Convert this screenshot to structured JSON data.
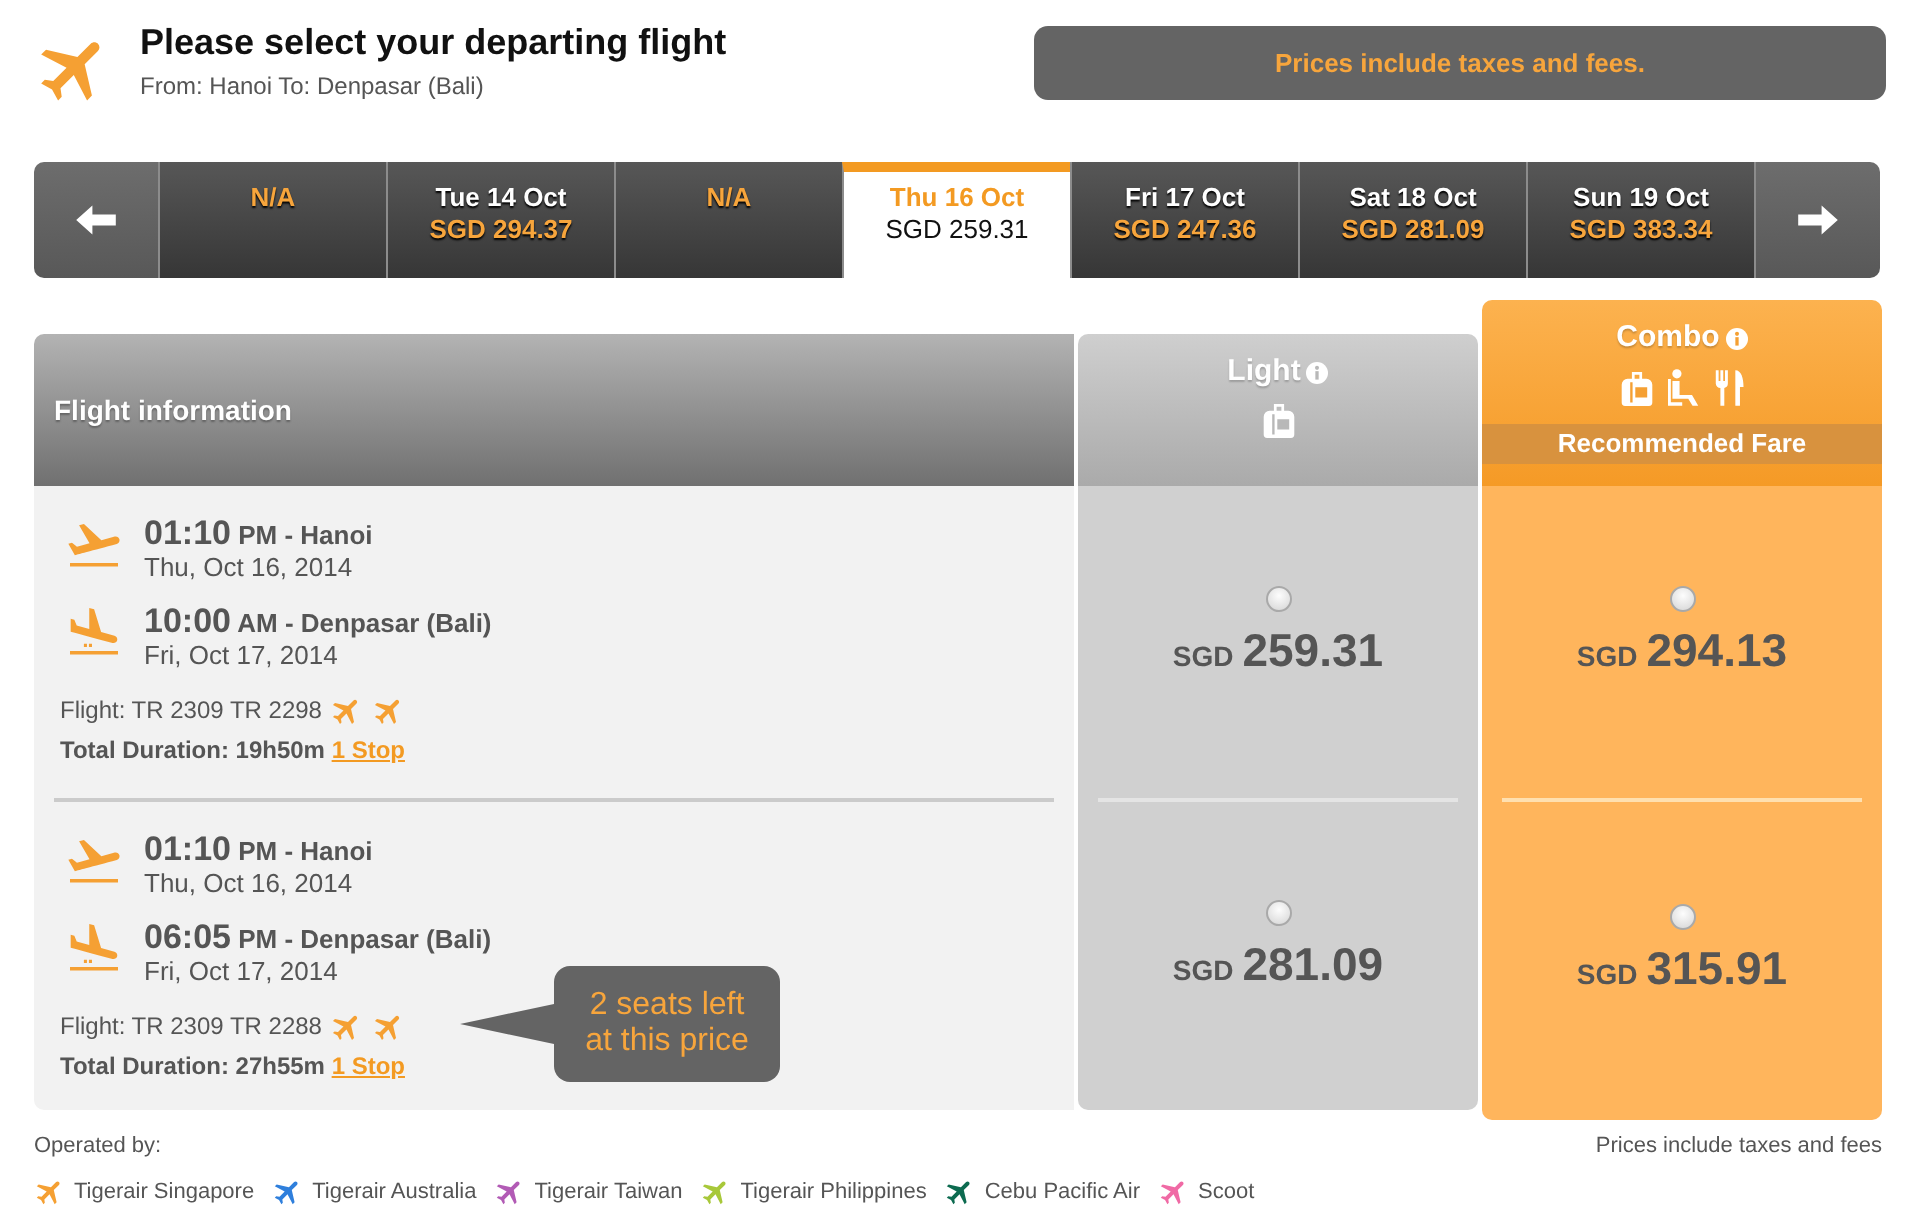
{
  "header": {
    "title": "Please select your departing flight",
    "route": "From: Hanoi To: Denpasar (Bali)"
  },
  "price_notice": "Prices include taxes and fees.",
  "date_strip": {
    "dates": [
      {
        "kind": "unavailable",
        "label": "N/A",
        "selected": false
      },
      {
        "kind": "available",
        "date": "Tue 14 Oct",
        "price": "SGD 294.37",
        "selected": false
      },
      {
        "kind": "unavailable",
        "label": "N/A",
        "selected": false
      },
      {
        "kind": "available",
        "date": "Thu 16 Oct",
        "price": "SGD 259.31",
        "selected": true
      },
      {
        "kind": "available",
        "date": "Fri 17 Oct",
        "price": "SGD 247.36",
        "selected": false
      },
      {
        "kind": "available",
        "date": "Sat 18 Oct",
        "price": "SGD 281.09",
        "selected": false
      },
      {
        "kind": "available",
        "date": "Sun 19 Oct",
        "price": "SGD 383.34",
        "selected": false
      }
    ]
  },
  "table": {
    "info_heading": "Flight information",
    "fare_columns": [
      {
        "name": "Light",
        "kind": "light",
        "highlighted": false
      },
      {
        "name": "Combo",
        "kind": "combo",
        "highlighted": true,
        "badge": "Recommended Fare"
      }
    ],
    "flights": [
      {
        "segments": [
          {
            "kind": "departure",
            "time": "01:10",
            "suffix": "PM - Hanoi",
            "date": "Thu, Oct 16, 2014"
          },
          {
            "kind": "arrival",
            "time": "10:00",
            "suffix": "AM - Denpasar (Bali)",
            "date": "Fri, Oct 17, 2014"
          }
        ],
        "flight_numbers": "Flight: TR 2309 TR 2298",
        "operators": [
          {
            "color": "#f5a033"
          },
          {
            "color": "#f5a033"
          }
        ],
        "duration": "Total Duration: 19h50m",
        "stops": "1 Stop",
        "fares": [
          {
            "currency": "SGD",
            "amount": "259.31",
            "selected": false
          },
          {
            "currency": "SGD",
            "amount": "294.13",
            "selected": false
          }
        ]
      },
      {
        "segments": [
          {
            "kind": "departure",
            "time": "01:10",
            "suffix": "PM - Hanoi",
            "date": "Thu, Oct 16, 2014"
          },
          {
            "kind": "arrival",
            "time": "06:05",
            "suffix": "PM - Denpasar (Bali)",
            "date": "Fri, Oct 17, 2014"
          }
        ],
        "flight_numbers": "Flight: TR 2309 TR 2288",
        "operators": [
          {
            "color": "#f5a033"
          },
          {
            "color": "#f5a033"
          }
        ],
        "duration": "Total Duration: 27h55m",
        "stops": "1 Stop",
        "notice": "2 seats left at this price",
        "fares": [
          {
            "currency": "SGD",
            "amount": "281.09",
            "selected": false
          },
          {
            "currency": "SGD",
            "amount": "315.91",
            "selected": false
          }
        ]
      }
    ]
  },
  "footer": {
    "operated_by": "Operated by:",
    "note": "Prices include taxes and fees",
    "airlines": [
      {
        "name": "Tigerair Singapore",
        "color": "#f5a033"
      },
      {
        "name": "Tigerair Australia",
        "color": "#2f7fdc"
      },
      {
        "name": "Tigerair Taiwan",
        "color": "#b25bb5"
      },
      {
        "name": "Tigerair Philippines",
        "color": "#a8c83a"
      },
      {
        "name": "Cebu Pacific Air",
        "color": "#0d6b50"
      },
      {
        "name": "Scoot",
        "color": "#f06aa5"
      }
    ]
  }
}
